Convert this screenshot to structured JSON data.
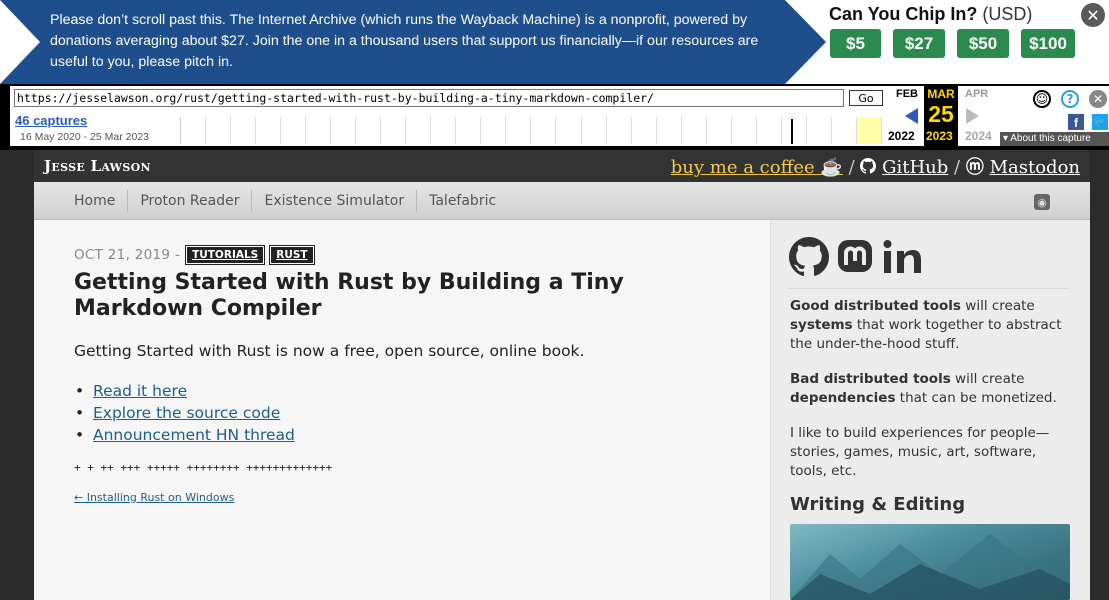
{
  "donation": {
    "message": "Please don’t scroll past this. The Internet Archive (which runs the Wayback Machine) is a nonprofit, powered by donations averaging about $27. Join the one in a thousand users that support us financially—if our resources are useful to you, please pitch in.",
    "ask": "Can You Chip In?",
    "currency": "(USD)",
    "amounts": [
      "$5",
      "$27",
      "$50",
      "$100"
    ],
    "close": "✕"
  },
  "wayback": {
    "url": "https://jesselawson.org/rust/getting-started-with-rust-by-building-a-tiny-markdown-compiler/",
    "go": "Go",
    "captures": "46 captures",
    "range": "16 May 2020 - 25 Mar 2023",
    "prev_month": "FEB",
    "cur_month": "MAR",
    "next_month": "APR",
    "day": "25",
    "prev_year": "2022",
    "cur_year": "2023",
    "next_year": "2024",
    "about": "▾ About this capture"
  },
  "site": {
    "logo": "Jesse Lawson",
    "coffee": "buy me a coffee ☕",
    "sep": "/",
    "github": "GitHub",
    "mastodon": "Mastodon"
  },
  "nav": [
    "Home",
    "Proton Reader",
    "Existence Simulator",
    "Talefabric"
  ],
  "post": {
    "date": "OCT 21, 2019 -",
    "tags": [
      "TUTORIALS",
      "RUST"
    ],
    "title": "Getting Started with Rust by Building a Tiny Markdown Compiler",
    "lead": "Getting Started with Rust is now a free, open source, online book.",
    "links": [
      "Read it here",
      "Explore the source code",
      "Announcement HN thread"
    ],
    "plus": "+ + ++ +++ +++++ ++++++++ +++++++++++++",
    "prev": "← Installing Rust on Windows"
  },
  "sidebar": {
    "p1_b1": "Good distributed tools",
    "p1_t1": " will create ",
    "p1_b2": "systems",
    "p1_t2": " that work together to abstract the under-the-hood stuff.",
    "p2_b1": "Bad distributed tools",
    "p2_t1": " will create ",
    "p2_b2": "dependencies",
    "p2_t2": " that can be monetized.",
    "p3": "I like to build experiences for people—stories, games, music, art, software, tools, etc.",
    "heading": "Writing & Editing"
  },
  "colors": {
    "banner": "#1f4e8c",
    "money": "#2b8a4d",
    "coffee": "#f2c94c",
    "link": "#1f5f8b"
  }
}
